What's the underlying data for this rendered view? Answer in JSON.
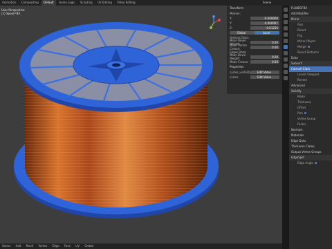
{
  "topbar": {
    "tabs": [
      "Animation",
      "Compositing",
      "Default",
      "Game Logic",
      "Scripting",
      "UV Editing",
      "Video Editing"
    ],
    "active_tab": "Default",
    "scene_label": "Scene"
  },
  "viewport": {
    "info_line1": "User Perspective",
    "info_line2": "(1) Spool FBX",
    "bottom_menu": [
      "Select",
      "Add",
      "Mesh",
      "Vertex",
      "Edge",
      "Face",
      "UV"
    ],
    "pivot_label": "Global"
  },
  "npanel": {
    "transform_header": "Transform",
    "median_label": "Median:",
    "x_label": "X:",
    "x_value": "-0.000006",
    "y_label": "Y:",
    "y_value": "-0.000007",
    "z_label": "Z:",
    "z_value": "-0.01235",
    "global_label": "Global",
    "local_label": "Local",
    "vertices_data_label": "Vertices Data:",
    "bevel_weight_label": "Mean Bevel Weight:",
    "bevel_weight_value": "0.00",
    "vcrease_label": "Mean Vertex Crease:",
    "vcrease_value": "0.00",
    "edges_data_label": "Edges Data:",
    "ebevel_label": "Mean Bevel Weight:",
    "ebevel_value": "0.00",
    "crease_label": "Mean Crease:",
    "crease_value": "0.00",
    "properties_header": "Properties",
    "prop1_label": "cycles_visibility",
    "prop1_btn": "Edit Value",
    "prop2_label": "cycles",
    "prop2_btn": "Edit Value"
  },
  "props": {
    "object_name": "FLUBB1FBX",
    "add_modifier": "Add Modifier",
    "mirror": "Mirror",
    "axis": "Axis",
    "bisect": "Bisect",
    "flip": "Flip",
    "mirror_object": "Mirror Object",
    "merge": "Merge",
    "bisect_distance": "Bisect Distance",
    "data": "Data",
    "subsurf": "Subsurf",
    "catmull": "Catmull-Clark",
    "levels_viewport": "Levels Viewport",
    "render": "Render",
    "advanced": "Advanced",
    "solidify": "Solidify",
    "mode": "Mode",
    "thickness": "Thickness",
    "offset": "Offset",
    "rim": "Rim",
    "vertex_group": "Vertex Group",
    "factor": "Factor",
    "normals": "Normals",
    "materials": "Materials",
    "edge_data": "Edge Data",
    "thickness_clamp": "Thickness Clamp",
    "output_vertex_groups": "Output Vertex Groups",
    "edgesplit": "EdgeSplit",
    "edge_angle": "Edge Angle"
  },
  "colors": {
    "spool_blue": "#2f63d8",
    "wire_copper": "#c4561c",
    "background": "#3d3d3d",
    "accent": "#4772b3"
  }
}
